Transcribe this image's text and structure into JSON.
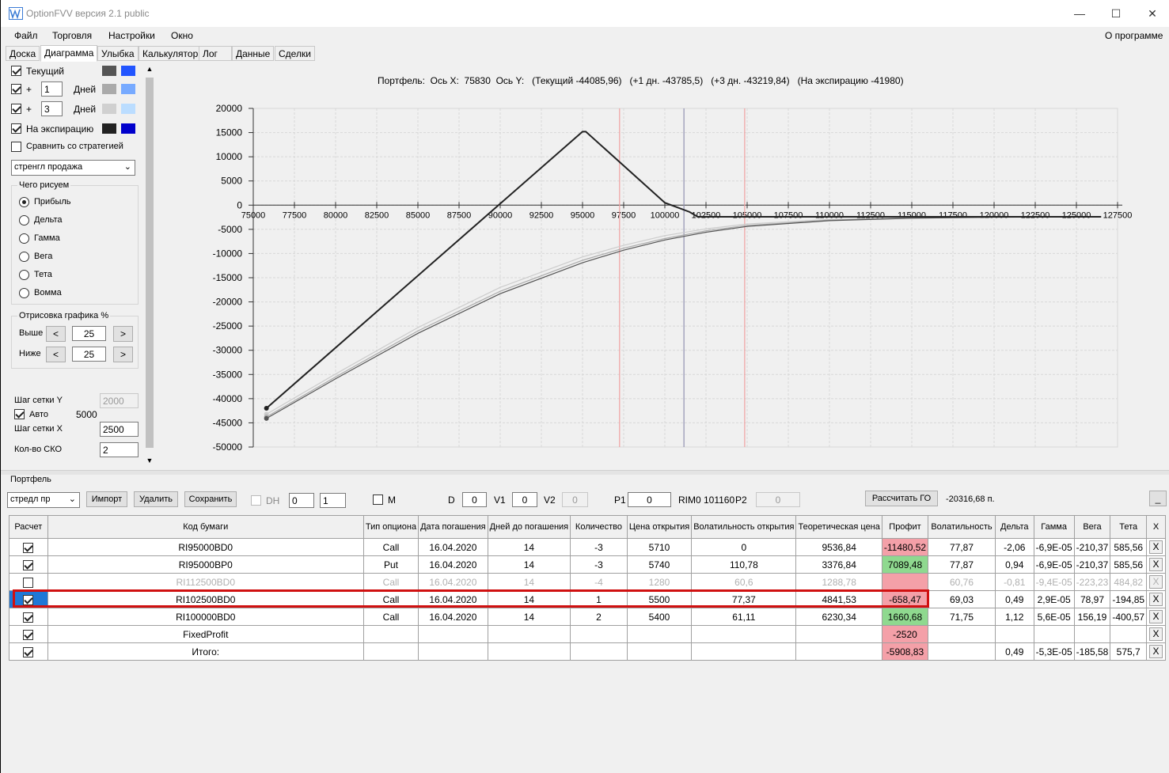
{
  "window": {
    "title": "OptionFVV версия 2.1 public",
    "minimize": "—",
    "maximize": "☐",
    "close": "✕"
  },
  "menu": {
    "items": [
      "Файл",
      "Торговля",
      "Настройки",
      "Окно"
    ],
    "about": "О программе"
  },
  "tabs": [
    "Доска",
    "Диаграмма",
    "Улыбка",
    "Калькулятор",
    "Лог",
    "Данные",
    "Сделки"
  ],
  "left": {
    "current": "Текущий",
    "plus": "+",
    "days": "Дней",
    "days1": "1",
    "days2": "3",
    "expiry": "На экспирацию",
    "compare": "Сравнить со стратегией",
    "strategy": "стренгл продажа",
    "what_title": "Чего рисуем",
    "radios": [
      "Прибыль",
      "Дельта",
      "Гамма",
      "Вега",
      "Тета",
      "Вомма"
    ],
    "render_title": "Отрисовка графика %",
    "above": "Выше",
    "below": "Ниже",
    "above_val": "25",
    "below_val": "25",
    "lt": "<",
    "gt": ">",
    "grid_y": "Шаг сетки Y",
    "grid_y_val": "2000",
    "auto": "Авто",
    "auto_val": "5000",
    "grid_x": "Шаг сетки X",
    "grid_x_val": "2500",
    "sko": "Кол-во СКО",
    "sko_val": "2",
    "colors": {
      "current_a": "#555555",
      "current_b": "#2255ff",
      "d1_a": "#aaaaaa",
      "d1_b": "#77aaff",
      "d3_a": "#d0d0d0",
      "d3_b": "#bbddff",
      "exp_a": "#222222",
      "exp_b": "#0000cc"
    }
  },
  "chart_header": "Портфель:  Ось X:  75830  Ось Y:   (Текущий -44085,96)   (+1 дн. -43785,5)   (+3 дн. -43219,84)   (На экспирацию -41980)",
  "chart_data": {
    "type": "line",
    "xlim": [
      75000,
      127500
    ],
    "ylim": [
      -50000,
      20000
    ],
    "x_ticks": [
      "75000",
      "77500",
      "80000",
      "82500",
      "85000",
      "87500",
      "90000",
      "92500",
      "95000",
      "97500",
      "100000",
      "102500",
      "105000",
      "107500",
      "110000",
      "112500",
      "115000",
      "117500",
      "120000",
      "122500",
      "125000",
      "127500"
    ],
    "y_ticks": [
      "20000",
      "15000",
      "10000",
      "5000",
      "0",
      "-5000",
      "-10000",
      "-15000",
      "-20000",
      "-25000",
      "-30000",
      "-35000",
      "-40000",
      "-45000",
      "-50000"
    ],
    "vlines": [
      {
        "x": 97250,
        "color": "#f0a0a0"
      },
      {
        "x": 101160,
        "color": "#9090b0"
      },
      {
        "x": 104850,
        "color": "#f0a0a0"
      }
    ],
    "series": [
      {
        "color": "#222222",
        "points": [
          [
            75800,
            -41980
          ],
          [
            95000,
            15200
          ],
          [
            95200,
            15200
          ],
          [
            100000,
            500
          ],
          [
            101500,
            -1400
          ],
          [
            102000,
            -2400
          ],
          [
            126500,
            -2400
          ]
        ]
      },
      {
        "color": "#555555",
        "points": [
          [
            75800,
            -44086
          ],
          [
            80000,
            -35900
          ],
          [
            85000,
            -26500
          ],
          [
            90000,
            -18300
          ],
          [
            95000,
            -11900
          ],
          [
            97500,
            -9300
          ],
          [
            100000,
            -7200
          ],
          [
            102500,
            -5600
          ],
          [
            105000,
            -4400
          ],
          [
            110000,
            -3200
          ],
          [
            115000,
            -2700
          ],
          [
            120000,
            -2500
          ],
          [
            126500,
            -2400
          ]
        ]
      },
      {
        "color": "#aaaaaa",
        "points": [
          [
            75800,
            -43785
          ],
          [
            80000,
            -35500
          ],
          [
            85000,
            -26000
          ],
          [
            90000,
            -17800
          ],
          [
            95000,
            -11400
          ],
          [
            97500,
            -8900
          ],
          [
            100000,
            -6900
          ],
          [
            102500,
            -5300
          ],
          [
            105000,
            -4200
          ],
          [
            110000,
            -3100
          ],
          [
            115000,
            -2650
          ],
          [
            120000,
            -2480
          ],
          [
            126500,
            -2400
          ]
        ]
      },
      {
        "color": "#cccccc",
        "points": [
          [
            75800,
            -43220
          ],
          [
            80000,
            -34900
          ],
          [
            85000,
            -25300
          ],
          [
            90000,
            -17000
          ],
          [
            95000,
            -10700
          ],
          [
            97500,
            -8300
          ],
          [
            100000,
            -6300
          ],
          [
            102500,
            -4900
          ],
          [
            105000,
            -3900
          ],
          [
            110000,
            -2950
          ],
          [
            115000,
            -2600
          ],
          [
            120000,
            -2450
          ],
          [
            126500,
            -2400
          ]
        ]
      }
    ]
  },
  "portfolio": {
    "title": "Портфель",
    "name": "стредл пр",
    "import": "Импорт",
    "delete": "Удалить",
    "save": "Сохранить",
    "dh": "DH",
    "dh_a": "0",
    "dh_b": "1",
    "m": "M",
    "d": "D",
    "d_val": "0",
    "v1": "V1",
    "v1_val": "0",
    "v2": "V2",
    "v2_val": "0",
    "p1": "P1",
    "p1_val": "0",
    "rim": "RIM0 101160",
    "p2": "P2",
    "p2_val": "0",
    "calc_go": "Рассчитать ГО",
    "go_val": "-20316,68 п.",
    "collapse": "_"
  },
  "table": {
    "headers": [
      "Расчет",
      "Код бумаги",
      "Тип опциона",
      "Дата погашения",
      "Дней до погашения",
      "Количество",
      "Цена открытия",
      "Волатильность открытия",
      "Теоретическая цена",
      "Профит",
      "Волатильность",
      "Дельта",
      "Гамма",
      "Вега",
      "Тета",
      "X"
    ],
    "rows": [
      {
        "check": true,
        "state": "",
        "cells": [
          "RI95000BD0",
          "Call",
          "16.04.2020",
          "14",
          "-3",
          "5710",
          "0",
          "9536,84",
          "-11480,52",
          "77,87",
          "-2,06",
          "-6,9E-05",
          "-210,37",
          "585,56",
          "X"
        ],
        "profit": "red"
      },
      {
        "check": true,
        "state": "",
        "cells": [
          "RI95000BP0",
          "Put",
          "16.04.2020",
          "14",
          "-3",
          "5740",
          "110,78",
          "3376,84",
          "7089,48",
          "77,87",
          "0,94",
          "-6,9E-05",
          "-210,37",
          "585,56",
          "X"
        ],
        "profit": "green"
      },
      {
        "check": false,
        "state": "grey",
        "cells": [
          "RI112500BD0",
          "Call",
          "16.04.2020",
          "14",
          "-4",
          "1280",
          "60,6",
          "1288,78",
          "",
          "60,76",
          "-0,81",
          "-9,4E-05",
          "-223,23",
          "484,82",
          "X"
        ],
        "profit": "red"
      },
      {
        "check": true,
        "state": "sel",
        "cells": [
          "RI102500BD0",
          "Call",
          "16.04.2020",
          "14",
          "1",
          "5500",
          "77,37",
          "4841,53",
          "-658,47",
          "69,03",
          "0,49",
          "2,9E-05",
          "78,97",
          "-194,85",
          "X"
        ],
        "profit": "red"
      },
      {
        "check": true,
        "state": "",
        "cells": [
          "RI100000BD0",
          "Call",
          "16.04.2020",
          "14",
          "2",
          "5400",
          "61,11",
          "6230,34",
          "1660,68",
          "71,75",
          "1,12",
          "5,6E-05",
          "156,19",
          "-400,57",
          "X"
        ],
        "profit": "green"
      },
      {
        "check": true,
        "state": "",
        "cells": [
          "FixedProfit",
          "",
          "",
          "",
          "",
          "",
          "",
          "",
          "-2520",
          "",
          "",
          "",
          "",
          "",
          "X"
        ],
        "profit": "red"
      },
      {
        "check": true,
        "state": "",
        "cells": [
          "Итого:",
          "",
          "",
          "",
          "",
          "",
          "",
          "",
          "-5908,83",
          "",
          "0,49",
          "-5,3E-05",
          "-185,58",
          "575,7",
          "X"
        ],
        "profit": "red"
      }
    ]
  }
}
